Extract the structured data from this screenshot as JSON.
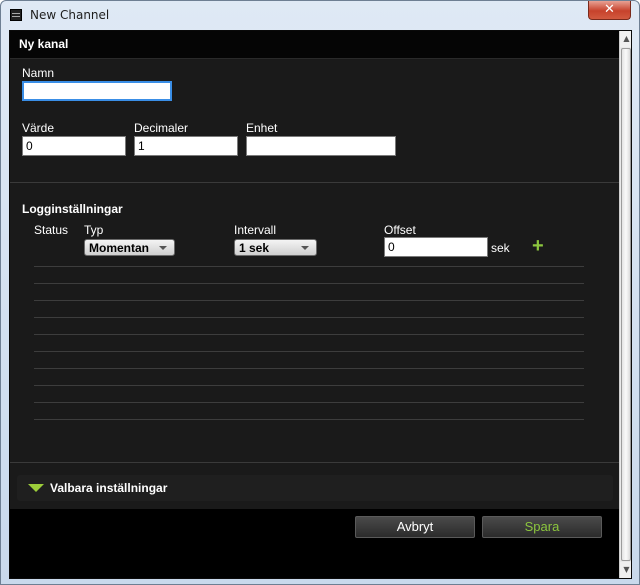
{
  "window": {
    "title": "New Channel",
    "close_label": "✕"
  },
  "header": {
    "title": "Ny kanal"
  },
  "form": {
    "name_label": "Namn",
    "name_value": "",
    "value_label": "Värde",
    "value_value": "0",
    "decimals_label": "Decimaler",
    "decimals_value": "1",
    "unit_label": "Enhet",
    "unit_value": ""
  },
  "logging": {
    "title": "Logginställningar",
    "col_status": "Status",
    "col_type": "Typ",
    "col_interval": "Intervall",
    "col_offset": "Offset",
    "type_selected": "Momentan",
    "interval_selected": "1 sek",
    "offset_value": "0",
    "offset_unit": "sek",
    "add_label": "+"
  },
  "optional": {
    "label": "Valbara inställningar"
  },
  "buttons": {
    "cancel": "Avbryt",
    "save": "Spara"
  },
  "colors": {
    "accent": "#8cc63e",
    "background": "#1a1a1a",
    "focus": "#3a8ee6"
  },
  "icons": {
    "app": "app-menu-icon",
    "expand": "triangle-down-icon",
    "add": "plus-icon"
  }
}
